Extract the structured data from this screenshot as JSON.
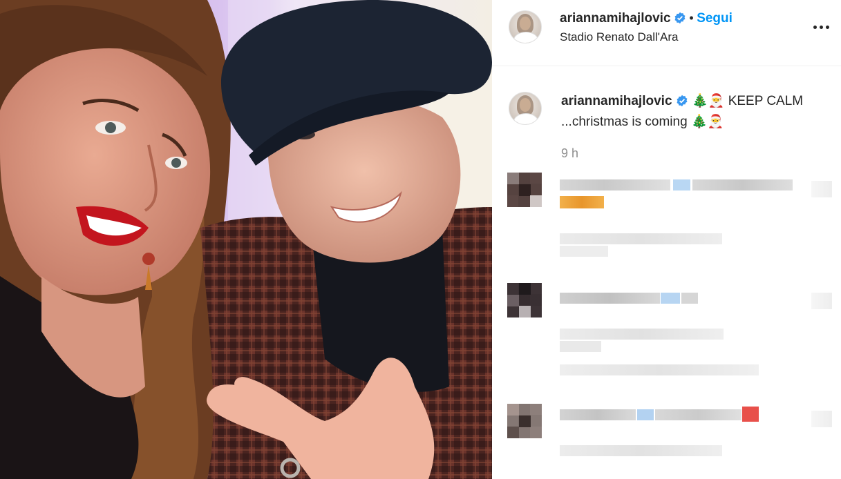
{
  "post": {
    "username": "ariannamihajlovic",
    "follow_label": "Segui",
    "separator": "•",
    "location": "Stadio Renato Dall'Ara",
    "caption_username": "ariannamihajlovic",
    "caption_line1_emoji1": "🎄",
    "caption_line1_emoji2": "🎅",
    "caption_line1_text": "KEEP CALM",
    "caption_line2_text": "...christmas is coming",
    "caption_line2_emoji1": "🎄",
    "caption_line2_emoji2": "🎅",
    "timestamp": "9 h"
  },
  "icons": {
    "verified": "verified-badge-icon",
    "more": "more-options-icon"
  },
  "colors": {
    "accent": "#0095f6",
    "text": "#262626",
    "muted": "#8e8e8e",
    "divider": "#efefef"
  }
}
